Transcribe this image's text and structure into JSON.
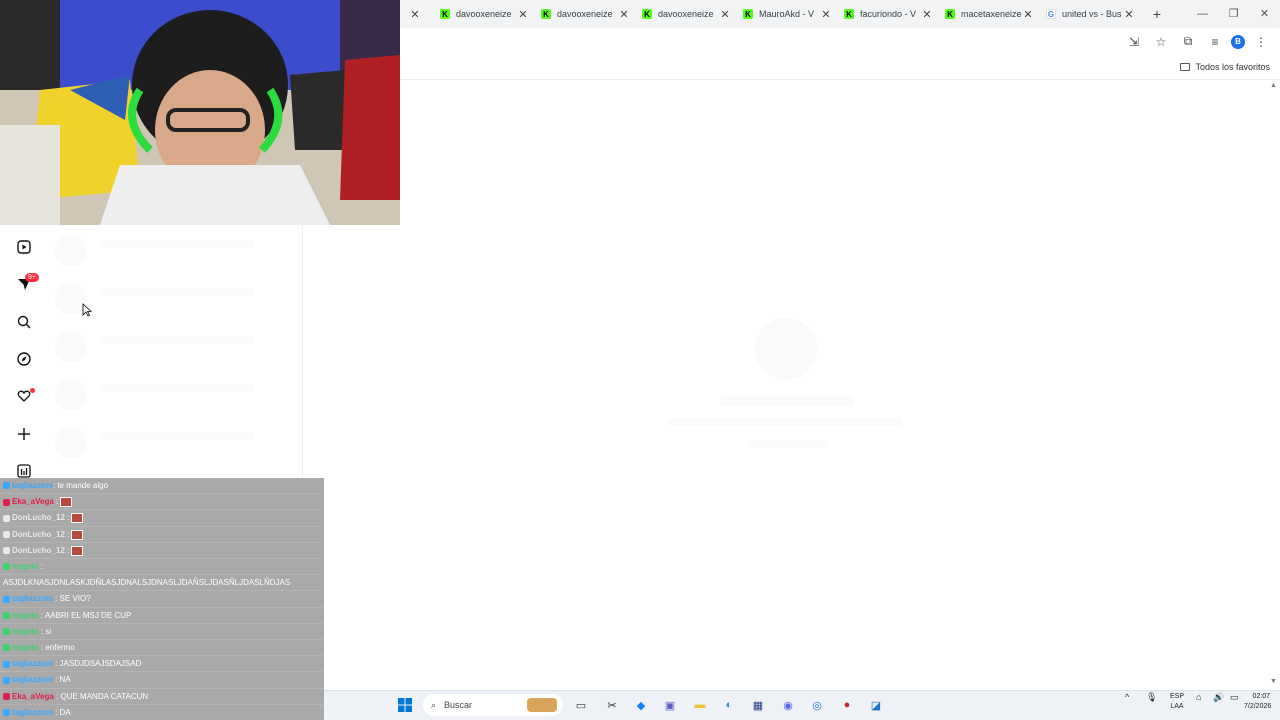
{
  "browser": {
    "tabs": [
      {
        "title": "davooxeneize",
        "favicon": "kick"
      },
      {
        "title": "davooxeneize",
        "favicon": "kick"
      },
      {
        "title": "davooxeneize",
        "favicon": "kick"
      },
      {
        "title": "MauroAkd - V",
        "favicon": "kick"
      },
      {
        "title": "facuriondo - V",
        "favicon": "kick"
      },
      {
        "title": "macetaxeneize",
        "favicon": "kick"
      },
      {
        "title": "united vs - Bus",
        "favicon": "google"
      }
    ],
    "profile_initial": "B",
    "bookmarks_label": "Todos los favoritos"
  },
  "sidebar": {
    "notification_badge": "9+",
    "icons": [
      "reels-icon",
      "messages-icon",
      "search-icon",
      "explore-icon",
      "heart-icon",
      "plus-icon",
      "stats-icon"
    ]
  },
  "chat": {
    "messages": [
      {
        "user": "tagliazzoni",
        "text": ": te mande algo",
        "user_color": "#3aa8ff",
        "emote": false
      },
      {
        "user": "Eka_aVega",
        "text": " :",
        "user_color": "#e0204a",
        "emote": true
      },
      {
        "user": "DonLucho_12",
        "text": " :",
        "user_color": "#e8e8e8",
        "emote": true
      },
      {
        "user": "DonLucho_12",
        "text": " :",
        "user_color": "#e8e8e8",
        "emote": true
      },
      {
        "user": "DonLucho_12",
        "text": " :",
        "user_color": "#e8e8e8",
        "emote": true
      },
      {
        "user": "nngolo",
        "text": " :",
        "user_color": "#3fd16a",
        "emote": false
      },
      {
        "user": "",
        "text": "ASJDLKNASJDNLASKJDÑLASJDNALSJDNASLJDAÑSLJDASÑLJDASLÑDJAS",
        "user_color": "#ffffff",
        "emote": false
      },
      {
        "user": "tagliazzoni",
        "text": " : SE VIO?",
        "user_color": "#3aa8ff",
        "emote": false
      },
      {
        "user": "nngolo",
        "text": " : AABRI EL MSJ DE CUP",
        "user_color": "#3fd16a",
        "emote": false
      },
      {
        "user": "nngolo",
        "text": " : si",
        "user_color": "#3fd16a",
        "emote": false
      },
      {
        "user": "nngolo",
        "text": " : enfermo",
        "user_color": "#3fd16a",
        "emote": false
      },
      {
        "user": "tagliazzoni",
        "text": " : JASDJDSAJSDAJSAD",
        "user_color": "#3aa8ff",
        "emote": false
      },
      {
        "user": "tagliazzoni",
        "text": " : NA",
        "user_color": "#3aa8ff",
        "emote": false
      },
      {
        "user": "Eka_aVega",
        "text": " : QUE MANDA CATACUN",
        "user_color": "#e0204a",
        "emote": false
      },
      {
        "user": "tagliazzoni",
        "text": " : DA",
        "user_color": "#3aa8ff",
        "emote": false
      },
      {
        "user": "tagliazzoni",
        "text": " : DA",
        "user_color": "#3aa8ff",
        "emote": false
      }
    ]
  },
  "taskbar": {
    "search_placeholder": "Buscar",
    "lang_top": "ESP",
    "lang_bottom": "LAA",
    "time": "02:07",
    "date": "7/2/2026"
  }
}
